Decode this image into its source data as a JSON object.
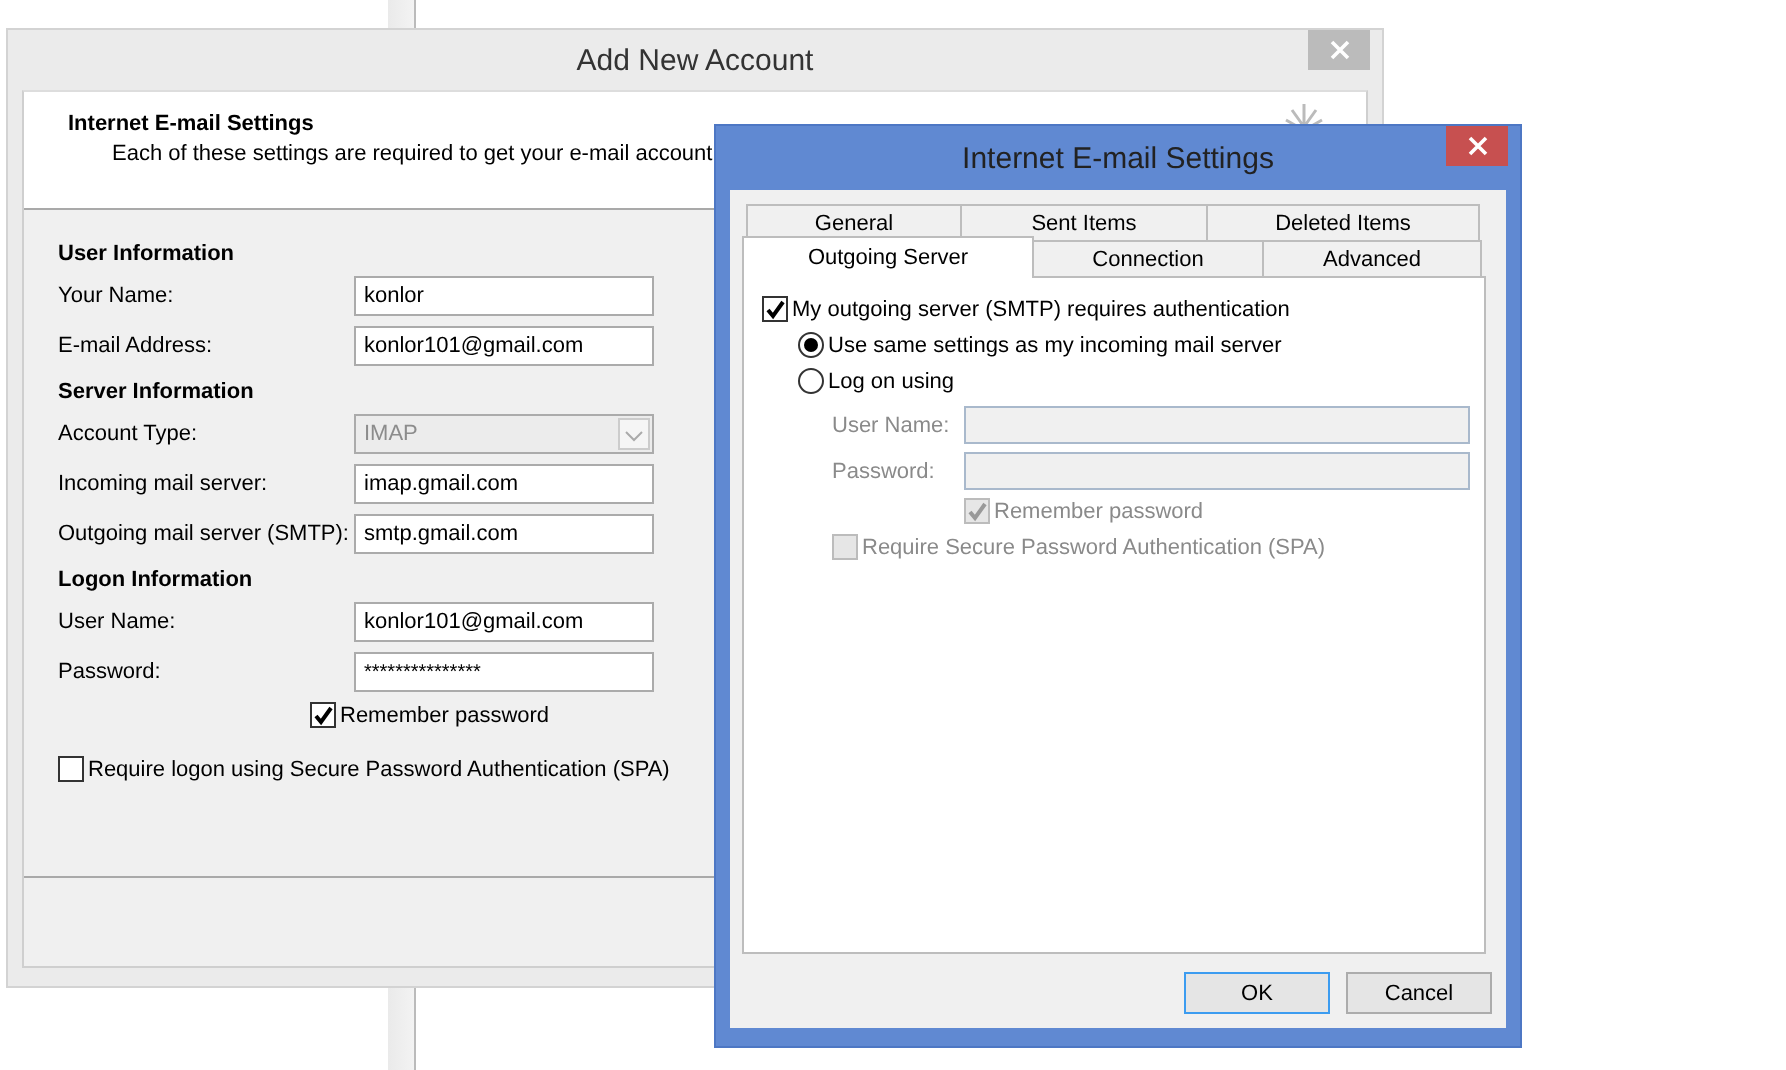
{
  "account_window": {
    "title": "Add New Account",
    "header": {
      "title": "Internet E-mail Settings",
      "subtitle": "Each of these settings are required to get your e-mail account"
    },
    "sections": [
      {
        "heading": "User Information",
        "fields": [
          {
            "label": "Your Name:",
            "value": "konlor",
            "kind": "text",
            "disabled": false
          },
          {
            "label": "E-mail Address:",
            "value": "konlor101@gmail.com",
            "kind": "text",
            "disabled": false
          }
        ]
      },
      {
        "heading": "Server Information",
        "fields": [
          {
            "label": "Account Type:",
            "value": "IMAP",
            "kind": "dropdown",
            "disabled": true
          },
          {
            "label": "Incoming mail server:",
            "value": "imap.gmail.com",
            "kind": "text",
            "disabled": false
          },
          {
            "label": "Outgoing mail server (SMTP):",
            "value": "smtp.gmail.com",
            "kind": "text",
            "disabled": false
          }
        ]
      },
      {
        "heading": "Logon Information",
        "fields": [
          {
            "label": "User Name:",
            "value": "konlor101@gmail.com",
            "kind": "text",
            "disabled": false
          },
          {
            "label": "Password:",
            "value": "***************",
            "kind": "password",
            "disabled": false
          }
        ]
      }
    ],
    "remember_password": {
      "label": "Remember password",
      "checked": true
    },
    "spa": {
      "label": "Require logon using Secure Password Authentication (SPA)",
      "checked": false
    }
  },
  "settings_dialog": {
    "title": "Internet E-mail Settings",
    "tab_rows": [
      [
        {
          "label": "General",
          "selected": false
        },
        {
          "label": "Sent Items",
          "selected": false
        },
        {
          "label": "Deleted Items",
          "selected": false
        }
      ],
      [
        {
          "label": "Outgoing Server",
          "selected": true
        },
        {
          "label": "Connection",
          "selected": false
        },
        {
          "label": "Advanced",
          "selected": false
        }
      ]
    ],
    "requires_auth": {
      "label": "My outgoing server (SMTP) requires authentication",
      "checked": true
    },
    "logon_options": [
      {
        "label": "Use same settings as my incoming mail server",
        "selected": true
      },
      {
        "label": "Log on using",
        "selected": false
      }
    ],
    "logon_fields": [
      {
        "label": "User Name:",
        "disabled": true
      },
      {
        "label": "Password:",
        "disabled": true
      }
    ],
    "remember_password": {
      "label": "Remember password",
      "checked": true,
      "disabled": true
    },
    "spa": {
      "label": "Require Secure Password Authentication (SPA)",
      "checked": false,
      "disabled": true
    },
    "buttons": [
      {
        "label": "OK",
        "default": true
      },
      {
        "label": "Cancel",
        "default": false
      }
    ]
  }
}
